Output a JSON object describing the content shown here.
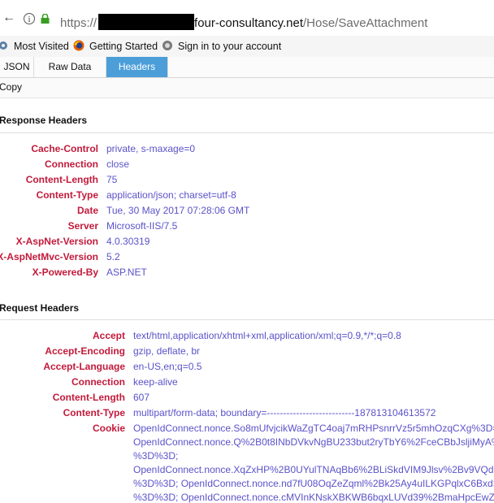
{
  "browser": {
    "url_prefix": "https://",
    "url_host_rest": "four-consultancy.net",
    "url_path": "/Hose/SaveAttachment",
    "bookmarks": [
      "Most Visited",
      "Getting Started",
      "Sign in to your account"
    ]
  },
  "tabs": [
    "JSON",
    "Raw Data",
    "Headers"
  ],
  "active_tab": "Headers",
  "toolbar": {
    "copy": "Copy"
  },
  "response": {
    "title": "Response Headers",
    "headers": [
      {
        "name": "Cache-Control",
        "value": "private, s-maxage=0"
      },
      {
        "name": "Connection",
        "value": "close"
      },
      {
        "name": "Content-Length",
        "value": "75"
      },
      {
        "name": "Content-Type",
        "value": "application/json; charset=utf-8"
      },
      {
        "name": "Date",
        "value": "Tue, 30 May 2017 07:28:06 GMT"
      },
      {
        "name": "Server",
        "value": "Microsoft-IIS/7.5"
      },
      {
        "name": "X-AspNet-Version",
        "value": "4.0.30319"
      },
      {
        "name": "X-AspNetMvc-Version",
        "value": "5.2"
      },
      {
        "name": "X-Powered-By",
        "value": "ASP.NET"
      }
    ]
  },
  "request": {
    "title": "Request Headers",
    "headers": [
      {
        "name": "Accept",
        "value": "text/html,application/xhtml+xml,application/xml;q=0.9,*/*;q=0.8"
      },
      {
        "name": "Accept-Encoding",
        "value": "gzip, deflate, br"
      },
      {
        "name": "Accept-Language",
        "value": "en-US,en;q=0.5"
      },
      {
        "name": "Connection",
        "value": "keep-alive"
      },
      {
        "name": "Content-Length",
        "value": "607"
      },
      {
        "name": "Content-Type",
        "value": "multipart/form-data; boundary=---------------------------187813104613572"
      },
      {
        "name": "Cookie",
        "value": "OpenIdConnect.nonce.So8mUfvjcikWaZgTC4oaj7mRHPsnrrVz5r5mhOzqCXg%3D=d"
      }
    ],
    "cookie_continuation": [
      "OpenIdConnect.nonce.Q%2B0t8INbDVkvNgBU233but2ryTbY6%2FceCBbJsljiMyA%3",
      "%3D%3D;",
      "OpenIdConnect.nonce.XqZxHP%2B0UYulTNAqBb6%2BLiSkdVIM9Jlsv%2Bv9VQdCzu",
      "%3D%3D; OpenIdConnect.nonce.nd7fU08OqZeZqml%2Bk25Ay4uILKGPqlxC6BxdSCg",
      "%3D%3D; OpenIdConnect.nonce.cMVInKNskXBKWB6bqxLUVd39%2BmaHpcEwZiFTr"
    ]
  },
  "colors": {
    "header_name": "#c21a3b",
    "header_value": "#5a52c9",
    "active_tab": "#4c9ed9"
  }
}
